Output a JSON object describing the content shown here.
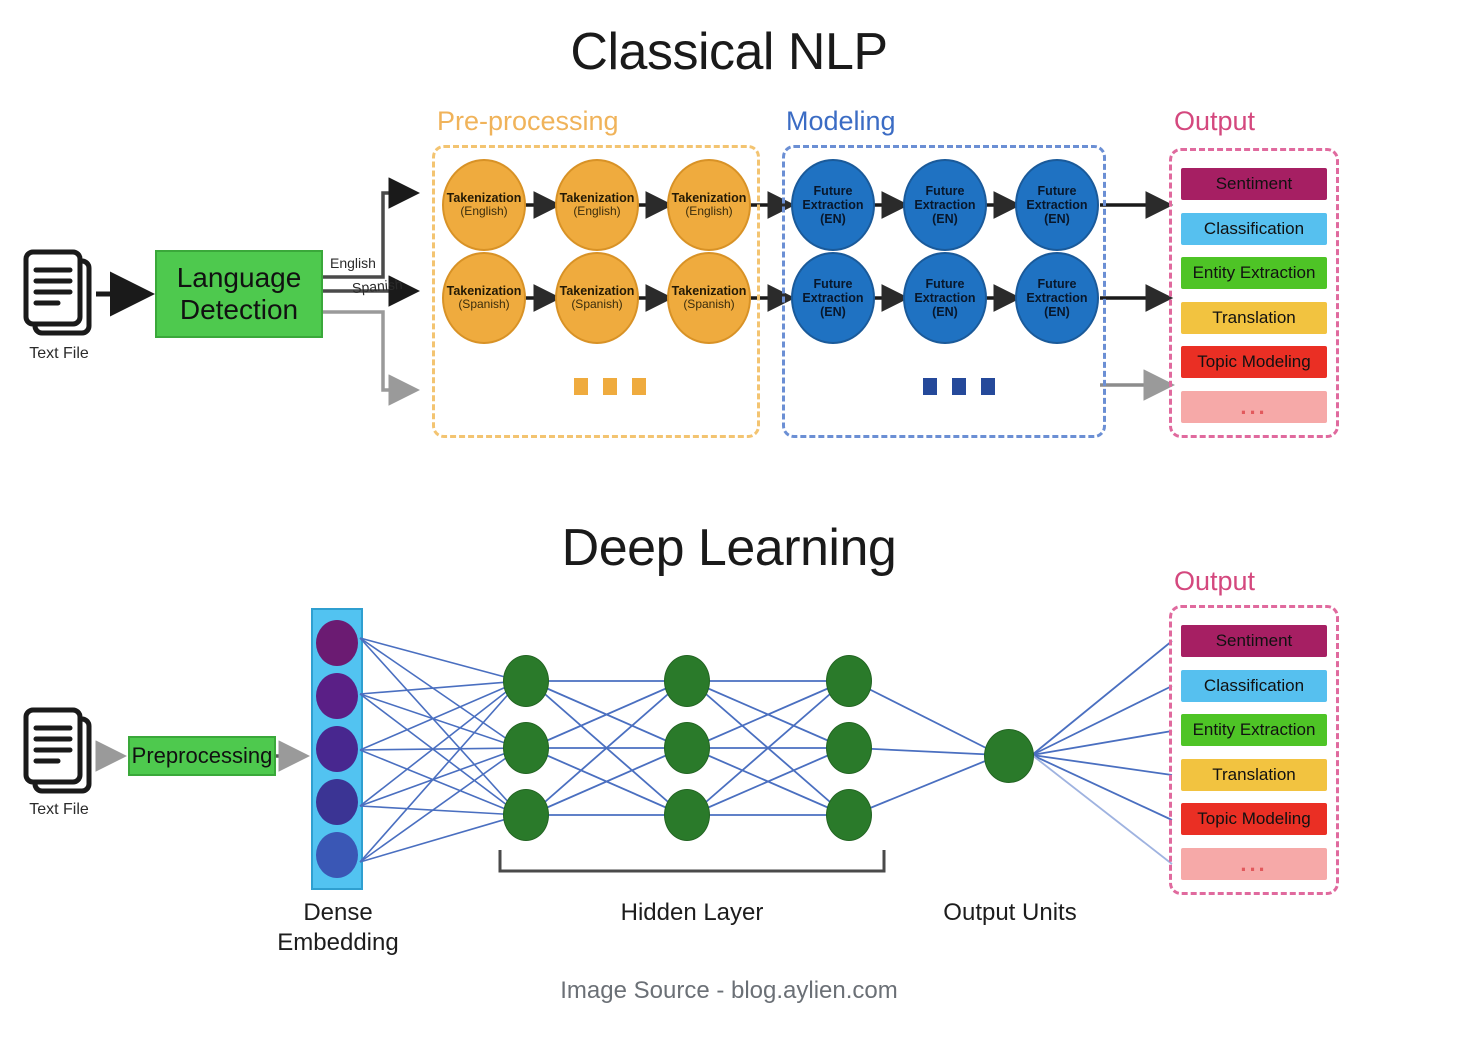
{
  "figure": {
    "footer": "Image Source - blog.aylien.com"
  },
  "classical": {
    "title": "Classical NLP",
    "input": {
      "icon": "text-file-icon",
      "caption": "Text File"
    },
    "language_detection": {
      "label_line1": "Language",
      "label_line2": "Detection",
      "color": "#4ec94e"
    },
    "branch_labels": {
      "english": "English",
      "spanish": "Spanish"
    },
    "stages": [
      {
        "key": "preprocessing",
        "heading": "Pre-processing",
        "heading_color": "#f0b35a",
        "border_color": "#f3c471",
        "node_color": "#efab3e",
        "dots_color": "#efab3e",
        "rows": [
          {
            "language": "English",
            "nodes": [
              {
                "line1": "Takenization",
                "line2": "(English)"
              },
              {
                "line1": "Takenization",
                "line2": "(English)"
              },
              {
                "line1": "Takenization",
                "line2": "(English)"
              }
            ]
          },
          {
            "language": "Spanish",
            "nodes": [
              {
                "line1": "Takenization",
                "line2": "(Spanish)"
              },
              {
                "line1": "Takenization",
                "line2": "(Spanish)"
              },
              {
                "line1": "Takenization",
                "line2": "(Spanish)"
              }
            ]
          }
        ]
      },
      {
        "key": "modeling",
        "heading": "Modeling",
        "heading_color": "#3b6cc4",
        "border_color": "#6b8fd4",
        "node_color": "#1f72c2",
        "dots_color": "#25499a",
        "rows": [
          {
            "language": "English",
            "nodes": [
              {
                "line1": "Future",
                "line2": "Extraction",
                "line3": "(EN)"
              },
              {
                "line1": "Future",
                "line2": "Extraction",
                "line3": "(EN)"
              },
              {
                "line1": "Future",
                "line2": "Extraction",
                "line3": "(EN)"
              }
            ]
          },
          {
            "language": "Spanish",
            "nodes": [
              {
                "line1": "Future",
                "line2": "Extraction",
                "line3": "(EN)"
              },
              {
                "line1": "Future",
                "line2": "Extraction",
                "line3": "(EN)"
              },
              {
                "line1": "Future",
                "line2": "Extraction",
                "line3": "(EN)"
              }
            ]
          }
        ]
      }
    ],
    "output": {
      "heading": "Output",
      "heading_color": "#d4487e",
      "border_color": "#e06a9e",
      "items": [
        {
          "label": "Sentiment",
          "color": "#a61f63"
        },
        {
          "label": "Classification",
          "color": "#56c0ef"
        },
        {
          "label": "Entity Extraction",
          "color": "#4ec426"
        },
        {
          "label": "Translation",
          "color": "#f2c340"
        },
        {
          "label": "Topic Modeling",
          "color": "#ea2f24"
        },
        {
          "label": "...",
          "color": "#f6a9a8"
        }
      ]
    }
  },
  "deep_learning": {
    "title": "Deep Learning",
    "input": {
      "icon": "text-file-icon",
      "caption": "Text File"
    },
    "preprocessing": {
      "label": "Preprocessing",
      "color": "#4ec94e"
    },
    "dense_embedding": {
      "label_line1": "Dense",
      "label_line2": "Embedding",
      "panel_color": "#52c3f1",
      "node_count": 5,
      "node_colors": [
        "#6b1b72",
        "#5a1f86",
        "#48278f",
        "#3b3494",
        "#3a57b5"
      ]
    },
    "hidden_layer": {
      "label": "Hidden Layer",
      "columns": 3,
      "nodes_per_column": 3,
      "node_color": "#2a7a2a",
      "edge_color": "#4a6fc0"
    },
    "output_units": {
      "label": "Output Units",
      "node_color": "#2a7a2a",
      "count": 1
    },
    "output": {
      "heading": "Output",
      "heading_color": "#d4487e",
      "border_color": "#e06a9e",
      "items": [
        {
          "label": "Sentiment",
          "color": "#a61f63"
        },
        {
          "label": "Classification",
          "color": "#56c0ef"
        },
        {
          "label": "Entity Extraction",
          "color": "#4ec426"
        },
        {
          "label": "Translation",
          "color": "#f2c340"
        },
        {
          "label": "Topic Modeling",
          "color": "#ea2f24"
        },
        {
          "label": "...",
          "color": "#f6a9a8"
        }
      ]
    }
  }
}
